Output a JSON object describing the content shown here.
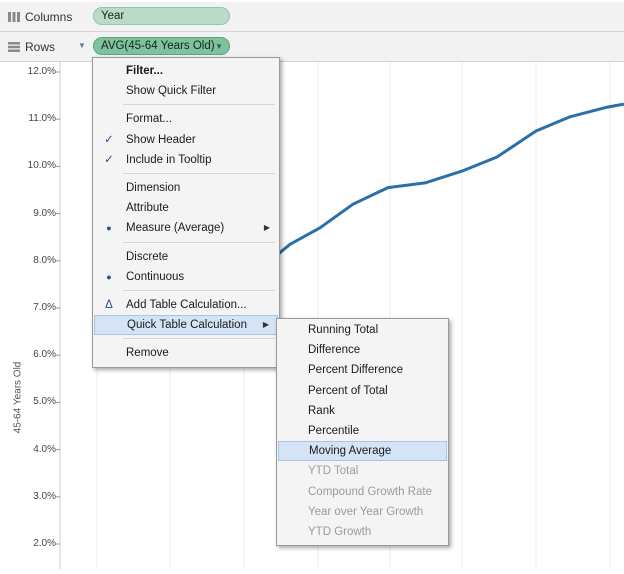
{
  "shelves": {
    "columns": {
      "label": "Columns",
      "pill": "Year"
    },
    "rows": {
      "label": "Rows",
      "pill": "AVG(45-64 Years Old)"
    }
  },
  "chart_data": {
    "type": "line",
    "ylabel": "45-64 Years Old",
    "yticks": [
      "12.0%",
      "11.0%",
      "10.0%",
      "9.0%",
      "8.0%",
      "7.0%",
      "6.0%",
      "5.0%",
      "4.0%",
      "3.0%",
      "2.0%"
    ],
    "ylim": [
      1.5,
      12.2
    ],
    "grid": true,
    "series": [
      {
        "values": [
          8.0,
          8.35,
          8.7,
          9.2,
          9.55,
          9.65,
          9.9,
          10.2,
          10.75,
          11.05,
          11.25,
          11.32
        ]
      }
    ],
    "color": "#2b6ea8"
  },
  "context_menu": {
    "items": [
      {
        "label": "Filter...",
        "bold": true
      },
      {
        "label": "Show Quick Filter"
      },
      {
        "separator": true
      },
      {
        "label": "Format..."
      },
      {
        "label": "Show Header",
        "mark": "✓"
      },
      {
        "label": "Include in Tooltip",
        "mark": "✓"
      },
      {
        "separator": true
      },
      {
        "label": "Dimension"
      },
      {
        "label": "Attribute"
      },
      {
        "label": "Measure (Average)",
        "mark": "●",
        "submenu": true
      },
      {
        "separator": true
      },
      {
        "label": "Discrete"
      },
      {
        "label": "Continuous",
        "mark": "●"
      },
      {
        "separator": true
      },
      {
        "label": "Add Table Calculation...",
        "mark": "Δ"
      },
      {
        "label": "Quick Table Calculation",
        "submenu": true,
        "highlighted": true
      },
      {
        "separator": true
      },
      {
        "label": "Remove"
      }
    ]
  },
  "submenu": {
    "items": [
      {
        "label": "Running Total"
      },
      {
        "label": "Difference"
      },
      {
        "label": "Percent Difference"
      },
      {
        "label": "Percent of Total"
      },
      {
        "label": "Rank"
      },
      {
        "label": "Percentile"
      },
      {
        "label": "Moving Average",
        "highlighted": true
      },
      {
        "label": "YTD Total",
        "disabled": true
      },
      {
        "label": "Compound Growth Rate",
        "disabled": true
      },
      {
        "label": "Year over Year Growth",
        "disabled": true
      },
      {
        "label": "YTD Growth",
        "disabled": true
      }
    ]
  }
}
